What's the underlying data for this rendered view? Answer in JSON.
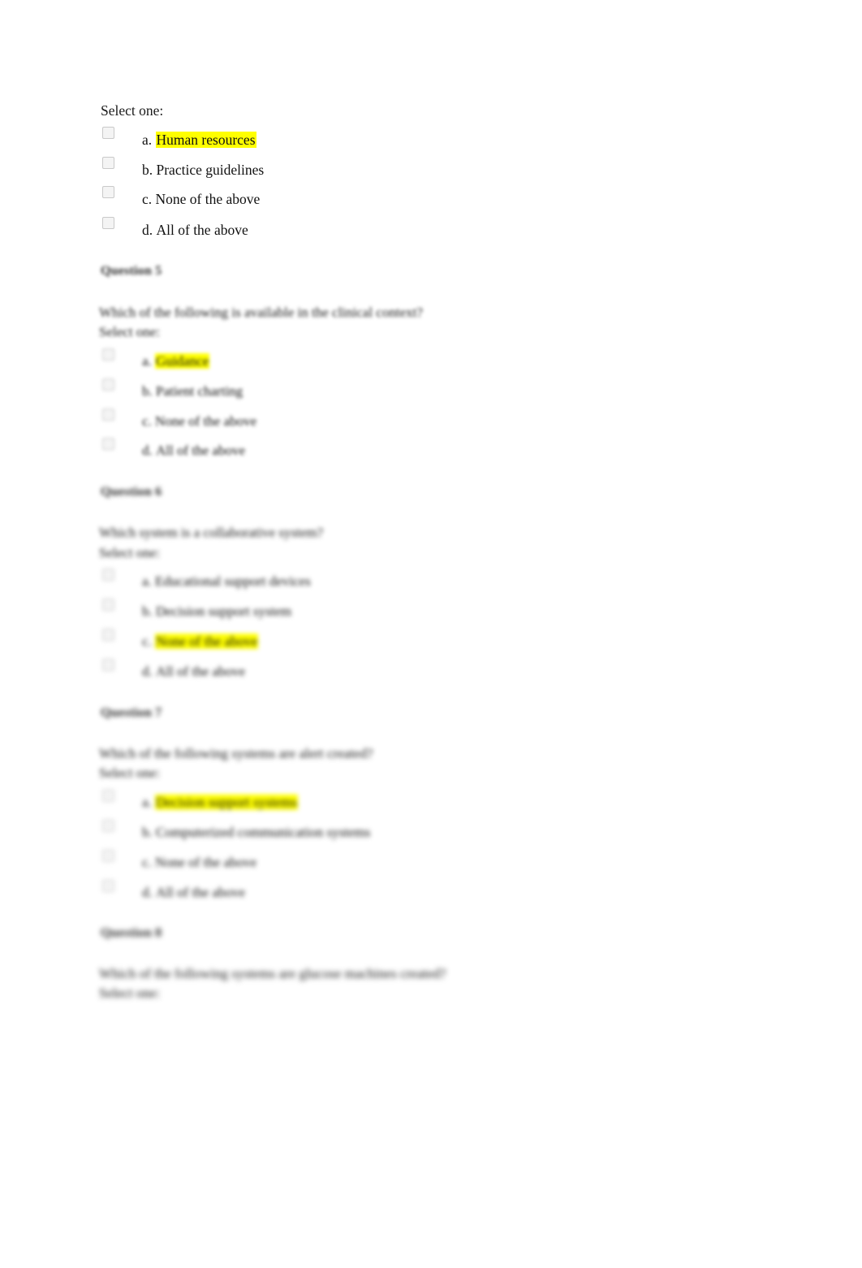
{
  "document": {
    "background_color": "#ffffff",
    "highlight_color": "#ffff00",
    "text_color": "#000000"
  },
  "sections": [
    {
      "id": "section-1",
      "heading": null,
      "question_text": null,
      "select_prompt": "Select one:",
      "legible": true,
      "options": [
        {
          "letter": "a.",
          "text": "Human resources",
          "highlighted": true
        },
        {
          "letter": "b.",
          "text": "Practice guidelines",
          "highlighted": false
        },
        {
          "letter": "c.",
          "text": "None of the above",
          "highlighted": false
        },
        {
          "letter": "d.",
          "text": "All of the above",
          "highlighted": false
        }
      ]
    },
    {
      "id": "section-2",
      "heading": "Question 5",
      "question_text": "Which of the following is available in the clinical context?",
      "select_prompt": "Select one:",
      "legible": false,
      "options": [
        {
          "letter": "a.",
          "text": "Guidance",
          "highlighted": true
        },
        {
          "letter": "b.",
          "text": "Patient charting",
          "highlighted": false
        },
        {
          "letter": "c.",
          "text": "None of the above",
          "highlighted": false
        },
        {
          "letter": "d.",
          "text": "All of the above",
          "highlighted": false
        }
      ]
    },
    {
      "id": "section-3",
      "heading": "Question 6",
      "question_text": "Which system is a collaborative system?",
      "select_prompt": "Select one:",
      "legible": false,
      "options": [
        {
          "letter": "a.",
          "text": "Educational support devices",
          "highlighted": false
        },
        {
          "letter": "b.",
          "text": "Decision support system",
          "highlighted": false
        },
        {
          "letter": "c.",
          "text": "None of the above",
          "highlighted": true
        },
        {
          "letter": "d.",
          "text": "All of the above",
          "highlighted": false
        }
      ]
    },
    {
      "id": "section-4",
      "heading": "Question 7",
      "question_text": "Which of the following systems are alert created?",
      "select_prompt": "Select one:",
      "legible": false,
      "options": [
        {
          "letter": "a.",
          "text": "Decision support systems",
          "highlighted": true
        },
        {
          "letter": "b.",
          "text": "Computerized communication systems",
          "highlighted": false
        },
        {
          "letter": "c.",
          "text": "None of the above",
          "highlighted": false
        },
        {
          "letter": "d.",
          "text": "All of the above",
          "highlighted": false
        }
      ]
    },
    {
      "id": "section-5",
      "heading": "Question 8",
      "question_text": "Which of the following systems are glucose machines created?",
      "select_prompt": "Select one:",
      "legible": false,
      "options": []
    }
  ]
}
